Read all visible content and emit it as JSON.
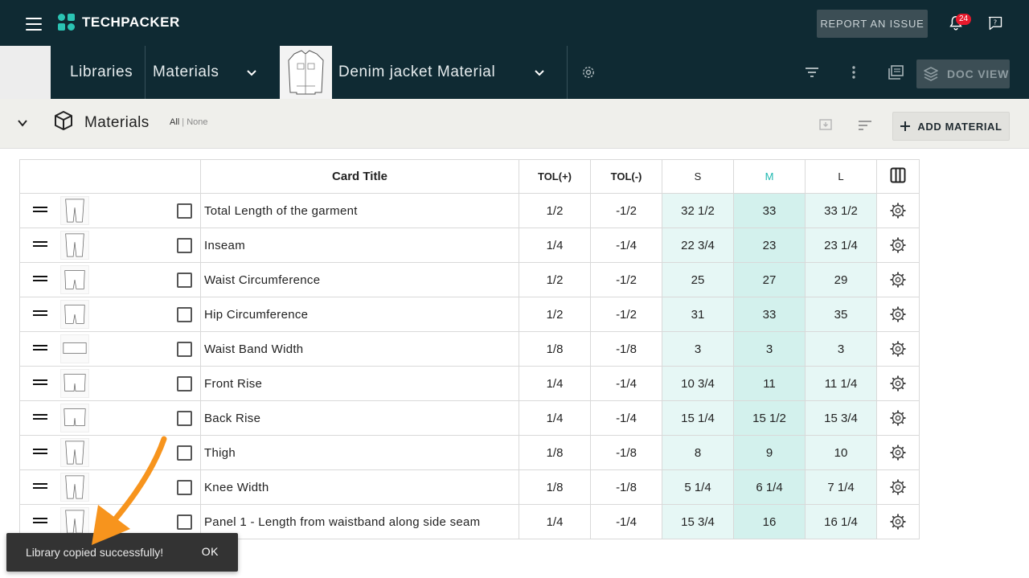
{
  "app": {
    "brand": "TECHPACKER",
    "report_label": "REPORT AN ISSUE",
    "notification_count": "24"
  },
  "breadcrumb": {
    "libraries": "Libraries",
    "materials": "Materials",
    "document": "Denim jacket Material",
    "doc_view_label": "DOC VIEW"
  },
  "section": {
    "title": "Materials",
    "all": "All",
    "separator": "|",
    "none": "None",
    "add_label": "ADD MATERIAL"
  },
  "table": {
    "headers": {
      "title": "Card Title",
      "tol_plus": "TOL(+)",
      "tol_minus": "TOL(-)",
      "s": "S",
      "m": "M",
      "l": "L"
    },
    "rows": [
      {
        "title": "Total Length of the garment",
        "tol_plus": "1/2",
        "tol_minus": "-1/2",
        "s": "32 1/2",
        "m": "33",
        "l": "33 1/2"
      },
      {
        "title": "Inseam",
        "tol_plus": "1/4",
        "tol_minus": "-1/4",
        "s": "22 3/4",
        "m": "23",
        "l": "23 1/4"
      },
      {
        "title": "Waist Circumference",
        "tol_plus": "1/2",
        "tol_minus": "-1/2",
        "s": "25",
        "m": "27",
        "l": "29"
      },
      {
        "title": "Hip Circumference",
        "tol_plus": "1/2",
        "tol_minus": "-1/2",
        "s": "31",
        "m": "33",
        "l": "35"
      },
      {
        "title": "Waist Band Width",
        "tol_plus": "1/8",
        "tol_minus": "-1/8",
        "s": "3",
        "m": "3",
        "l": "3"
      },
      {
        "title": "Front Rise",
        "tol_plus": "1/4",
        "tol_minus": "-1/4",
        "s": "10 3/4",
        "m": "11",
        "l": "11 1/4"
      },
      {
        "title": "Back Rise",
        "tol_plus": "1/4",
        "tol_minus": "-1/4",
        "s": "15 1/4",
        "m": "15 1/2",
        "l": "15 3/4"
      },
      {
        "title": "Thigh",
        "tol_plus": "1/8",
        "tol_minus": "-1/8",
        "s": "8",
        "m": "9",
        "l": "10"
      },
      {
        "title": "Knee Width",
        "tol_plus": "1/8",
        "tol_minus": "-1/8",
        "s": "5 1/4",
        "m": "6 1/4",
        "l": "7 1/4"
      },
      {
        "title": "Panel 1 - Length from waistband along side seam",
        "tol_plus": "1/4",
        "tol_minus": "-1/4",
        "s": "15 3/4",
        "m": "16",
        "l": "16 1/4"
      }
    ]
  },
  "toast": {
    "message": "Library copied successfully!",
    "action": "OK"
  },
  "colors": {
    "header_bg": "#0f2a33",
    "accent": "#2bc4b4",
    "size_cell": "#e6f7f5",
    "size_cell_active": "#d3f1ed",
    "badge": "#e8192c",
    "annotation_arrow": "#f7941d"
  },
  "icons": [
    "menu-icon",
    "techpacker-logo-icon",
    "bell-icon",
    "help-icon",
    "chevron-down-icon",
    "settings-icon",
    "filter-icon",
    "more-vert-icon",
    "library-icon",
    "layers-icon",
    "cube-icon",
    "download-icon",
    "sort-icon",
    "plus-icon",
    "drag-handle-icon",
    "columns-icon"
  ]
}
